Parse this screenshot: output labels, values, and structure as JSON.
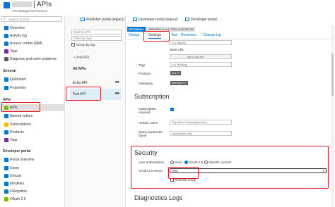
{
  "header": {
    "title": "APIs",
    "subtitle": "API Management service"
  },
  "sidebar": {
    "search_placeholder": "Search (Ctrl+/)",
    "items": [
      {
        "label": "Overview",
        "icon": "overview-icon",
        "color": "#0078d4"
      },
      {
        "label": "Activity log",
        "icon": "activity-log-icon",
        "color": "#0078d4"
      },
      {
        "label": "Access control (IAM)",
        "icon": "people-icon",
        "color": "#0078d4"
      },
      {
        "label": "Tags",
        "icon": "tag-icon",
        "color": "#7a2e9e"
      },
      {
        "label": "Diagnose and solve problems",
        "icon": "wrench-icon",
        "color": "#605e5c"
      }
    ],
    "general_title": "General",
    "general_items": [
      {
        "label": "Quickstart",
        "icon": "quickstart-icon",
        "color": "#0078d4"
      },
      {
        "label": "Properties",
        "icon": "properties-icon",
        "color": "#0078d4"
      }
    ],
    "apis_title": "APIs",
    "apis_items": [
      {
        "label": "APIs",
        "icon": "api-icon",
        "color": "#7fba00"
      },
      {
        "label": "Named values",
        "icon": "named-values-icon",
        "color": "#0078d4"
      },
      {
        "label": "Subscriptions",
        "icon": "key-icon",
        "color": "#ffb900"
      },
      {
        "label": "Products",
        "icon": "products-icon",
        "color": "#0078d4"
      },
      {
        "label": "Tags",
        "icon": "tag-icon",
        "color": "#7a2e9e"
      }
    ],
    "dev_title": "Developer portal",
    "dev_items": [
      {
        "label": "Portal overview",
        "icon": "portal-icon",
        "color": "#0078d4"
      },
      {
        "label": "Users",
        "icon": "user-icon",
        "color": "#0078d4"
      },
      {
        "label": "Groups",
        "icon": "groups-icon",
        "color": "#0078d4"
      },
      {
        "label": "Identities",
        "icon": "identities-icon",
        "color": "#0078d4"
      },
      {
        "label": "Delegation",
        "icon": "delegation-icon",
        "color": "#0078d4"
      },
      {
        "label": "OAuth 2.0",
        "icon": "oauth-icon",
        "color": "#7fba00"
      }
    ]
  },
  "toolbar": {
    "publisher_portal": "Publisher portal (legacy)",
    "developer_portal_legacy": "Developer portal (legacy)",
    "developer_portal": "Developer portal"
  },
  "api_list": {
    "search_placeholder": "Search APIs",
    "filter_placeholder": "Filter by tags",
    "group_by_tag": "Group by tag",
    "add_api": "+ Add API",
    "all_apis": "All APIs",
    "items": [
      {
        "label": "Echo API",
        "dots": "•••"
      },
      {
        "label": "Test API",
        "dots": "•••"
      }
    ]
  },
  "revision": {
    "badge": "REVISION 1",
    "text": "CREATED Jun 8, 2020, 8:00:28 PM"
  },
  "tabs": [
    "Design",
    "Settings",
    "Test",
    "Revisions",
    "Change log"
  ],
  "settings": {
    "top_input": "e.g. httpbin",
    "base_url_label": "Base URL",
    "base_url_value": "azure-api.net",
    "tags_label": "Tags",
    "tags_placeholder": "e.g. Booking",
    "products_label": "Products",
    "products_chip": "test",
    "gateways_label": "Gateways",
    "gateways_chip": "Managed",
    "subscription_title": "Subscription",
    "subscription_required_label": "Subscription required",
    "header_name_label": "Header name",
    "header_name_value": "Ocp-Apim-Subscription-Key",
    "query_param_label": "Query parameter name",
    "query_param_value": "subscription-key",
    "security_title": "Security",
    "user_auth_label": "User authorization",
    "radio_none": "None",
    "radio_oauth": "OAuth 2.0",
    "radio_openid": "OpenID connect",
    "oauth_server_label": "OAuth 2.0 server",
    "oauth_server_value": "Test",
    "override_scope": "Override scope",
    "diagnostics_title": "Diagnostics Logs"
  }
}
